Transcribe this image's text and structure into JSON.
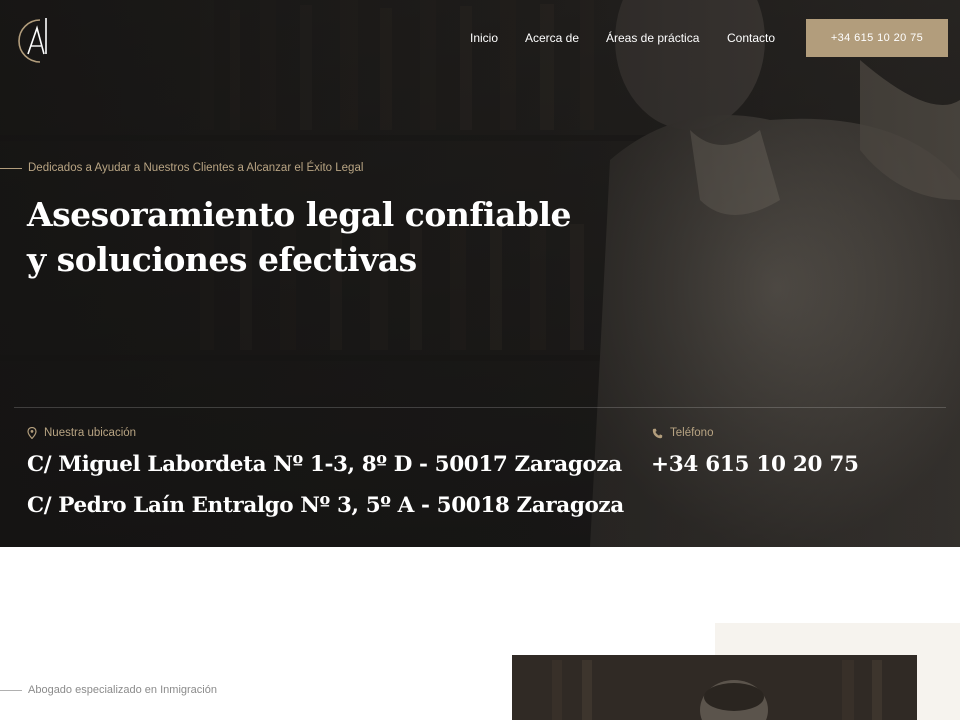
{
  "nav": {
    "items": [
      {
        "label": "Inicio"
      },
      {
        "label": "Acerca de"
      },
      {
        "label": "Áreas de práctica"
      },
      {
        "label": "Contacto"
      }
    ],
    "phone_button": "+34 615 10 20 75"
  },
  "hero": {
    "tagline": "Dedicados a Ayudar a Nuestros Clientes a Alcanzar el Éxito Legal",
    "title_line1": "Asesoramiento legal confiable",
    "title_line2": "y soluciones efectivas"
  },
  "contact": {
    "location_label": "Nuestra ubicación",
    "address_1": "C/ Miguel Labordeta Nº 1-3, 8º D - 50017 Zaragoza",
    "address_2": "C/ Pedro Laín Entralgo Nº 3, 5º A - 50018 Zaragoza",
    "phone_label": "Teléfono",
    "phone_value": "+34 615 10 20 75"
  },
  "about": {
    "subtitle": "Abogado especializado en Inmigración"
  },
  "colors": {
    "accent": "#b29d7c",
    "hero_bg": "#1b1a19",
    "text_light": "#ffffff"
  },
  "icons": [
    "logo-icon",
    "location-pin-icon",
    "phone-icon"
  ]
}
